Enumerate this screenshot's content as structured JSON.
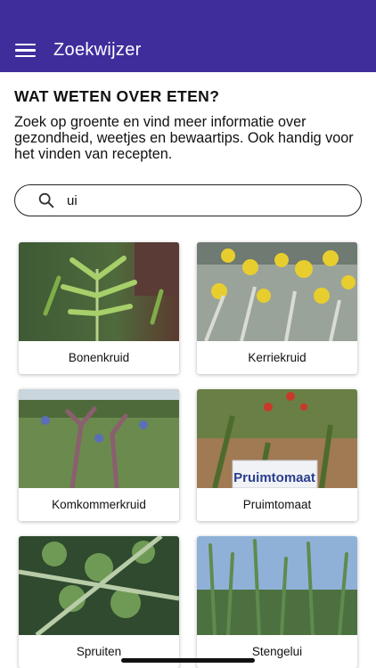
{
  "app": {
    "title": "Zoekwijzer"
  },
  "page": {
    "heading": "WAT WETEN OVER ETEN?",
    "intro": "Zoek op groente en vind meer informatie over gezondheid, weetjes en bewaartips. Ook handig voor het vinden van recepten."
  },
  "search": {
    "value": "ui",
    "icon": "search-icon"
  },
  "results": [
    {
      "label": "Bonenkruid"
    },
    {
      "label": "Kerriekruid"
    },
    {
      "label": "Komkommerkruid"
    },
    {
      "label": "Pruimtomaat",
      "photo_sign_text": "Pruimtomaat"
    },
    {
      "label": "Spruiten"
    },
    {
      "label": "Stengelui"
    }
  ],
  "colors": {
    "appbar": "#3f2d9c",
    "background": "#ffffff"
  }
}
